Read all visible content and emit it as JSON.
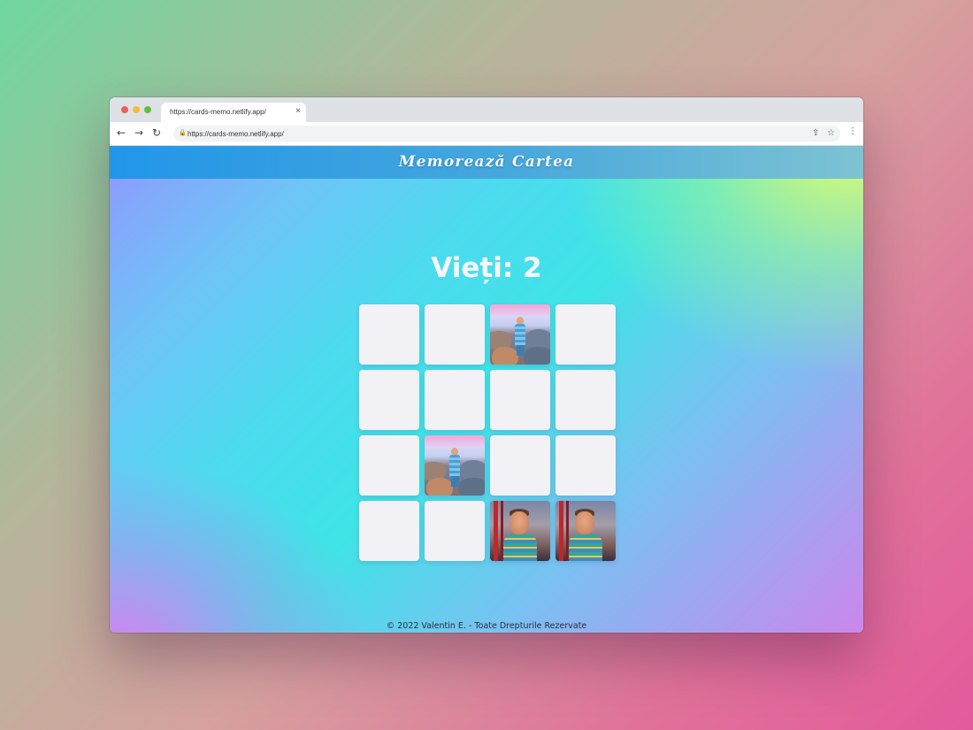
{
  "browser": {
    "tab_title": "https://cards-memo.netlify.app/",
    "tab_close": "×",
    "url": "https://cards-memo.netlify.app/",
    "icons": [
      "back-icon",
      "forward-icon",
      "reload-icon",
      "lock-icon",
      "share-icon",
      "star-icon",
      "menu-icon"
    ]
  },
  "app": {
    "title": "Memorează Cartea",
    "lives_text": "Vieți: 2",
    "footer": "© 2022 Valentin E. - Toate Drepturile Rezervate"
  },
  "cards": [
    {
      "state": "hidden"
    },
    {
      "state": "hidden"
    },
    {
      "state": "revealed",
      "image": "photo-rocks"
    },
    {
      "state": "hidden"
    },
    {
      "state": "hidden"
    },
    {
      "state": "hidden"
    },
    {
      "state": "hidden"
    },
    {
      "state": "hidden"
    },
    {
      "state": "hidden"
    },
    {
      "state": "revealed",
      "image": "photo-rocks"
    },
    {
      "state": "hidden"
    },
    {
      "state": "hidden"
    },
    {
      "state": "hidden"
    },
    {
      "state": "hidden"
    },
    {
      "state": "revealed",
      "image": "photo-boy"
    },
    {
      "state": "revealed",
      "image": "photo-boy"
    }
  ],
  "colors": {
    "header_start": "#2196e9",
    "header_end": "#7dc3d3",
    "card_back": "#f1f1f6",
    "title_text": "#f4f7ff"
  }
}
